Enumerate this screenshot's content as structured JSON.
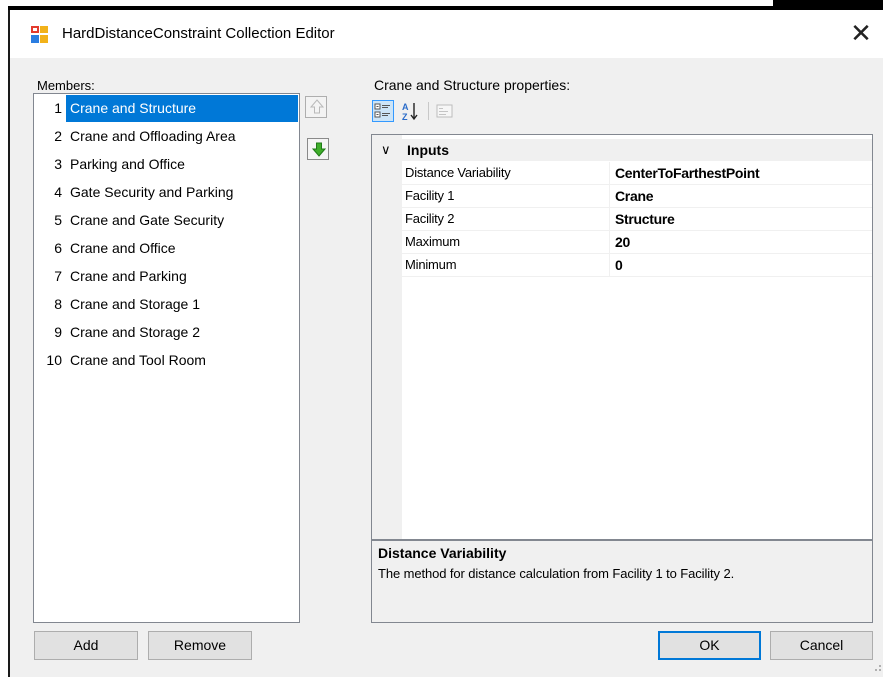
{
  "window": {
    "title": "HardDistanceConstraint Collection Editor",
    "close_symbol": "✕"
  },
  "members": {
    "label": "Members:",
    "items": [
      {
        "index": "1",
        "name": "Crane and Structure",
        "selected": true
      },
      {
        "index": "2",
        "name": "Crane and Offloading Area"
      },
      {
        "index": "3",
        "name": "Parking and Office"
      },
      {
        "index": "4",
        "name": "Gate Security and Parking"
      },
      {
        "index": "5",
        "name": "Crane and Gate Security"
      },
      {
        "index": "6",
        "name": "Crane and Office"
      },
      {
        "index": "7",
        "name": "Crane and Parking"
      },
      {
        "index": "8",
        "name": "Crane and Storage 1"
      },
      {
        "index": "9",
        "name": "Crane and Storage 2"
      },
      {
        "index": "10",
        "name": "Crane and Tool Room"
      }
    ],
    "move_up_icon": "arrow-up-icon",
    "move_down_icon": "arrow-down-icon"
  },
  "properties": {
    "label": "Crane and Structure properties:",
    "toolbar": {
      "categorized_icon": "categorized-icon",
      "alphabetical_icon": "sort-az-icon",
      "property_pages_icon": "property-pages-icon"
    },
    "category": {
      "chevron": "∨",
      "name": "Inputs",
      "rows": [
        {
          "name": "Distance Variability",
          "value": "CenterToFarthestPoint"
        },
        {
          "name": "Facility 1",
          "value": "Crane"
        },
        {
          "name": "Facility 2",
          "value": "Structure"
        },
        {
          "name": "Maximum",
          "value": "20"
        },
        {
          "name": "Minimum",
          "value": "0"
        }
      ]
    },
    "description": {
      "title": "Distance Variability",
      "text": "The method for distance calculation from Facility 1 to Facility 2."
    }
  },
  "buttons": {
    "add": "Add",
    "remove": "Remove",
    "ok": "OK",
    "cancel": "Cancel"
  },
  "colors": {
    "selection": "#0078d7",
    "window_bg": "#f0f0f0",
    "arrow_green": "#3fae2a"
  }
}
